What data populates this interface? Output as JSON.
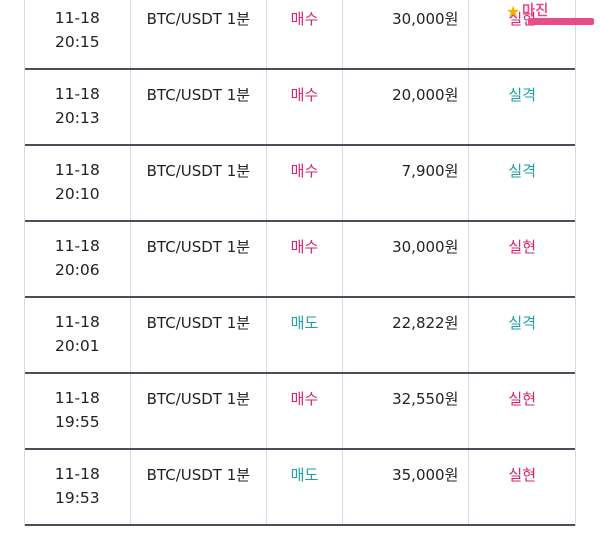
{
  "rows": [
    {
      "date": "11-18",
      "time": "20:15",
      "pair": "BTC/USDT 1분",
      "side": "매수",
      "side_type": "buy",
      "amount": "30,000원",
      "result": "실현",
      "result_type": "realized"
    },
    {
      "date": "11-18",
      "time": "20:13",
      "pair": "BTC/USDT 1분",
      "side": "매수",
      "side_type": "buy",
      "amount": "20,000원",
      "result": "실격",
      "result_type": "lost"
    },
    {
      "date": "11-18",
      "time": "20:10",
      "pair": "BTC/USDT 1분",
      "side": "매수",
      "side_type": "buy",
      "amount": "7,900원",
      "result": "실격",
      "result_type": "lost"
    },
    {
      "date": "11-18",
      "time": "20:06",
      "pair": "BTC/USDT 1분",
      "side": "매수",
      "side_type": "buy",
      "amount": "30,000원",
      "result": "실현",
      "result_type": "realized"
    },
    {
      "date": "11-18",
      "time": "20:01",
      "pair": "BTC/USDT 1분",
      "side": "매도",
      "side_type": "sell",
      "amount": "22,822원",
      "result": "실격",
      "result_type": "lost"
    },
    {
      "date": "11-18",
      "time": "19:55",
      "pair": "BTC/USDT 1분",
      "side": "매수",
      "side_type": "buy",
      "amount": "32,550원",
      "result": "실현",
      "result_type": "realized"
    },
    {
      "date": "11-18",
      "time": "19:53",
      "pair": "BTC/USDT 1분",
      "side": "매도",
      "side_type": "sell",
      "amount": "35,000원",
      "result": "실현",
      "result_type": "realized"
    }
  ],
  "watermark": {
    "text": "마진"
  },
  "colors": {
    "buy": "#d6246e",
    "sell": "#1ea0a6",
    "realized": "#d6246e",
    "lost": "#1ea0a6",
    "row_divider": "#4b4f59"
  }
}
